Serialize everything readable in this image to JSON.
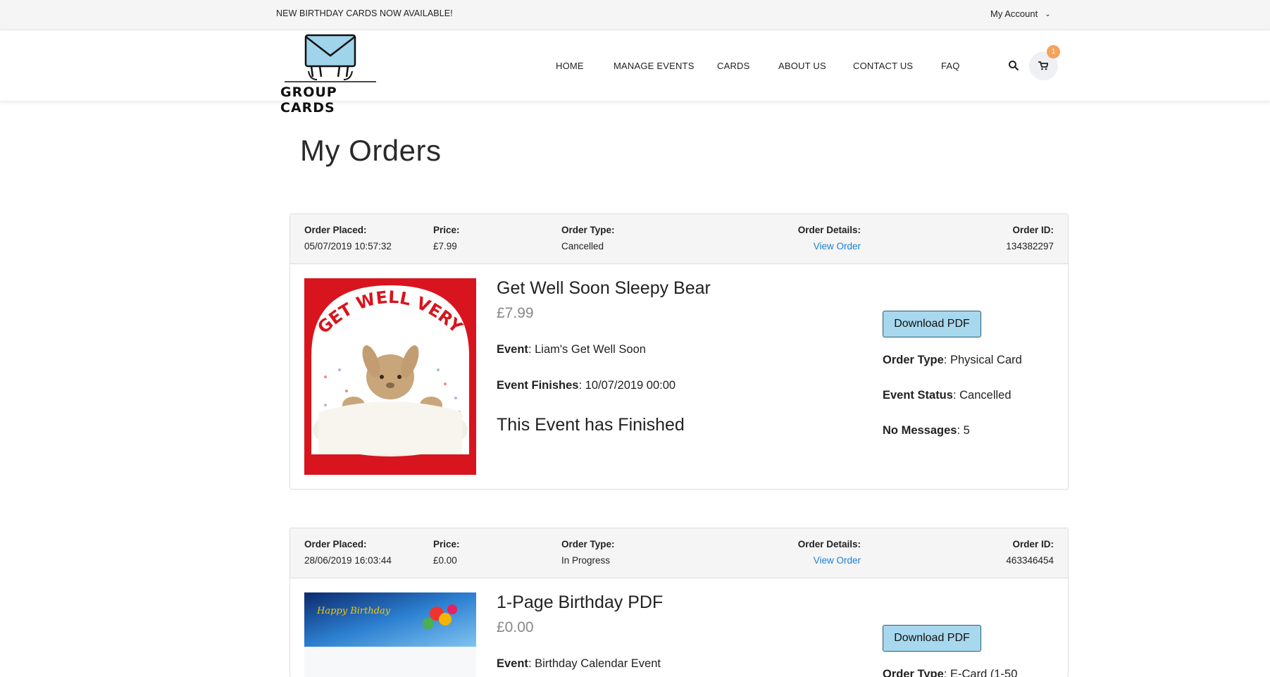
{
  "topbar": {
    "promo": "NEW BIRTHDAY CARDS NOW AVAILABLE!",
    "account_label": "My Account",
    "account_chevron": "⌄"
  },
  "brand": {
    "logo_text": "GROUP CARDS"
  },
  "nav": {
    "items": [
      "HOME",
      "MANAGE EVENTS",
      "CARDS",
      "ABOUT US",
      "CONTACT US",
      "FAQ"
    ]
  },
  "cart": {
    "count": "1"
  },
  "page": {
    "title": "My Orders"
  },
  "labels": {
    "order_placed": "Order Placed",
    "price": "Price",
    "order_type": "Order Type",
    "order_details": "Order Details",
    "order_id": "Order ID",
    "view_order": "View Order",
    "download_pdf": "Download PDF",
    "event": "Event",
    "event_finishes": "Event Finishes",
    "event_status": "Event Status",
    "no_messages": "No Messages",
    "colon": ":"
  },
  "orders": [
    {
      "placed": "05/07/2019 10:57:32",
      "price": "£7.99",
      "type": "Cancelled",
      "id": "134382297",
      "product_title": "Get Well Soon Sleepy Bear",
      "product_price": "£7.99",
      "event": "Liam's Get Well Soon",
      "event_finishes": "10/07/2019 00:00",
      "finished_note": "This Event has Finished",
      "card_type": "Physical Card",
      "event_status": "Cancelled",
      "messages": "5",
      "card_text": "GET WELL VERY SOON"
    },
    {
      "placed": "28/06/2019 16:03:44",
      "price": "£0.00",
      "type": "In Progress",
      "id": "463346454",
      "product_title": "1-Page Birthday PDF",
      "product_price": "£0.00",
      "event": "Birthday Calendar Event",
      "card_type": "E-Card (1-50",
      "card_text": "Happy Birthday"
    }
  ],
  "colors": {
    "link": "#1a7fd6",
    "button_bg": "#a8d8ee",
    "badge": "#f5a25d"
  }
}
